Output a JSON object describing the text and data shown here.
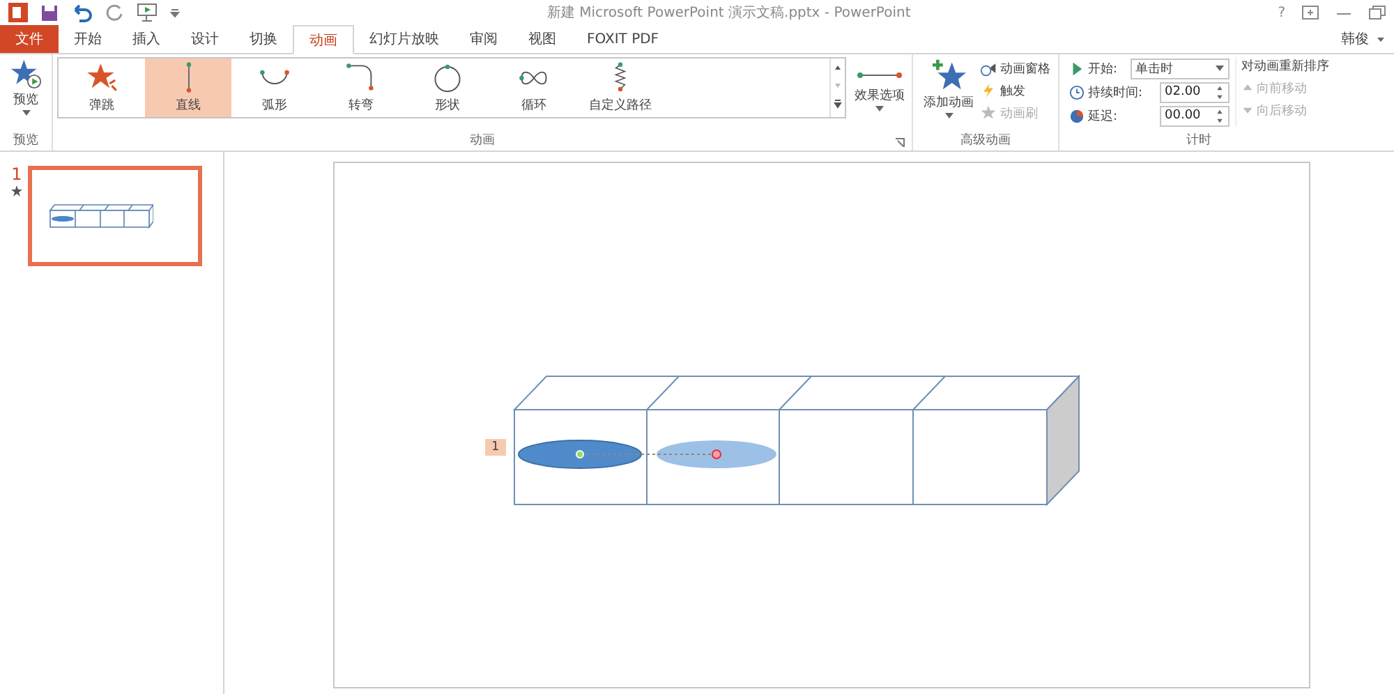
{
  "window": {
    "title": "新建 Microsoft PowerPoint 演示文稿.pptx - PowerPoint",
    "help": "?",
    "user": "韩俊"
  },
  "tabs": [
    {
      "label": "文件",
      "kind": "file",
      "selected": false
    },
    {
      "label": "开始",
      "kind": "tab",
      "selected": false
    },
    {
      "label": "插入",
      "kind": "tab",
      "selected": false
    },
    {
      "label": "设计",
      "kind": "tab",
      "selected": false
    },
    {
      "label": "切换",
      "kind": "tab",
      "selected": false
    },
    {
      "label": "动画",
      "kind": "tab",
      "selected": true
    },
    {
      "label": "幻灯片放映",
      "kind": "tab",
      "selected": false
    },
    {
      "label": "审阅",
      "kind": "tab",
      "selected": false
    },
    {
      "label": "视图",
      "kind": "tab",
      "selected": false
    },
    {
      "label": "FOXIT PDF",
      "kind": "tab",
      "selected": false
    }
  ],
  "preview_group": {
    "button": "预览",
    "label": "预览"
  },
  "animation_group": {
    "label": "动画",
    "effects_button": "效果选项",
    "effects": [
      {
        "label": "弹跳",
        "kind": "bounce",
        "selected": false
      },
      {
        "label": "直线",
        "kind": "line",
        "selected": true
      },
      {
        "label": "弧形",
        "kind": "arc",
        "selected": false
      },
      {
        "label": "转弯",
        "kind": "turn",
        "selected": false
      },
      {
        "label": "形状",
        "kind": "shape",
        "selected": false
      },
      {
        "label": "循环",
        "kind": "loop",
        "selected": false
      },
      {
        "label": "自定义路径",
        "kind": "custom",
        "selected": false
      }
    ]
  },
  "advanced_group": {
    "label": "高级动画",
    "add_button": "添加动画",
    "items": [
      {
        "label": "动画窗格",
        "kind": "pane",
        "disabled": false
      },
      {
        "label": "触发",
        "kind": "trigger",
        "disabled": false
      },
      {
        "label": "动画刷",
        "kind": "brush",
        "disabled": true
      }
    ]
  },
  "timing_group": {
    "label": "计时",
    "start_label": "开始:",
    "start_value": "单击时",
    "duration_label": "持续时间:",
    "duration_value": "02.00",
    "delay_label": "延迟:",
    "delay_value": "00.00",
    "reorder_title": "对动画重新排序",
    "move_earlier": {
      "label": "向前移动",
      "disabled": true
    },
    "move_later": {
      "label": "向后移动",
      "disabled": true
    }
  },
  "slides": [
    {
      "number": "1",
      "selected": true
    }
  ],
  "slide": {
    "animation_tag": "1"
  }
}
